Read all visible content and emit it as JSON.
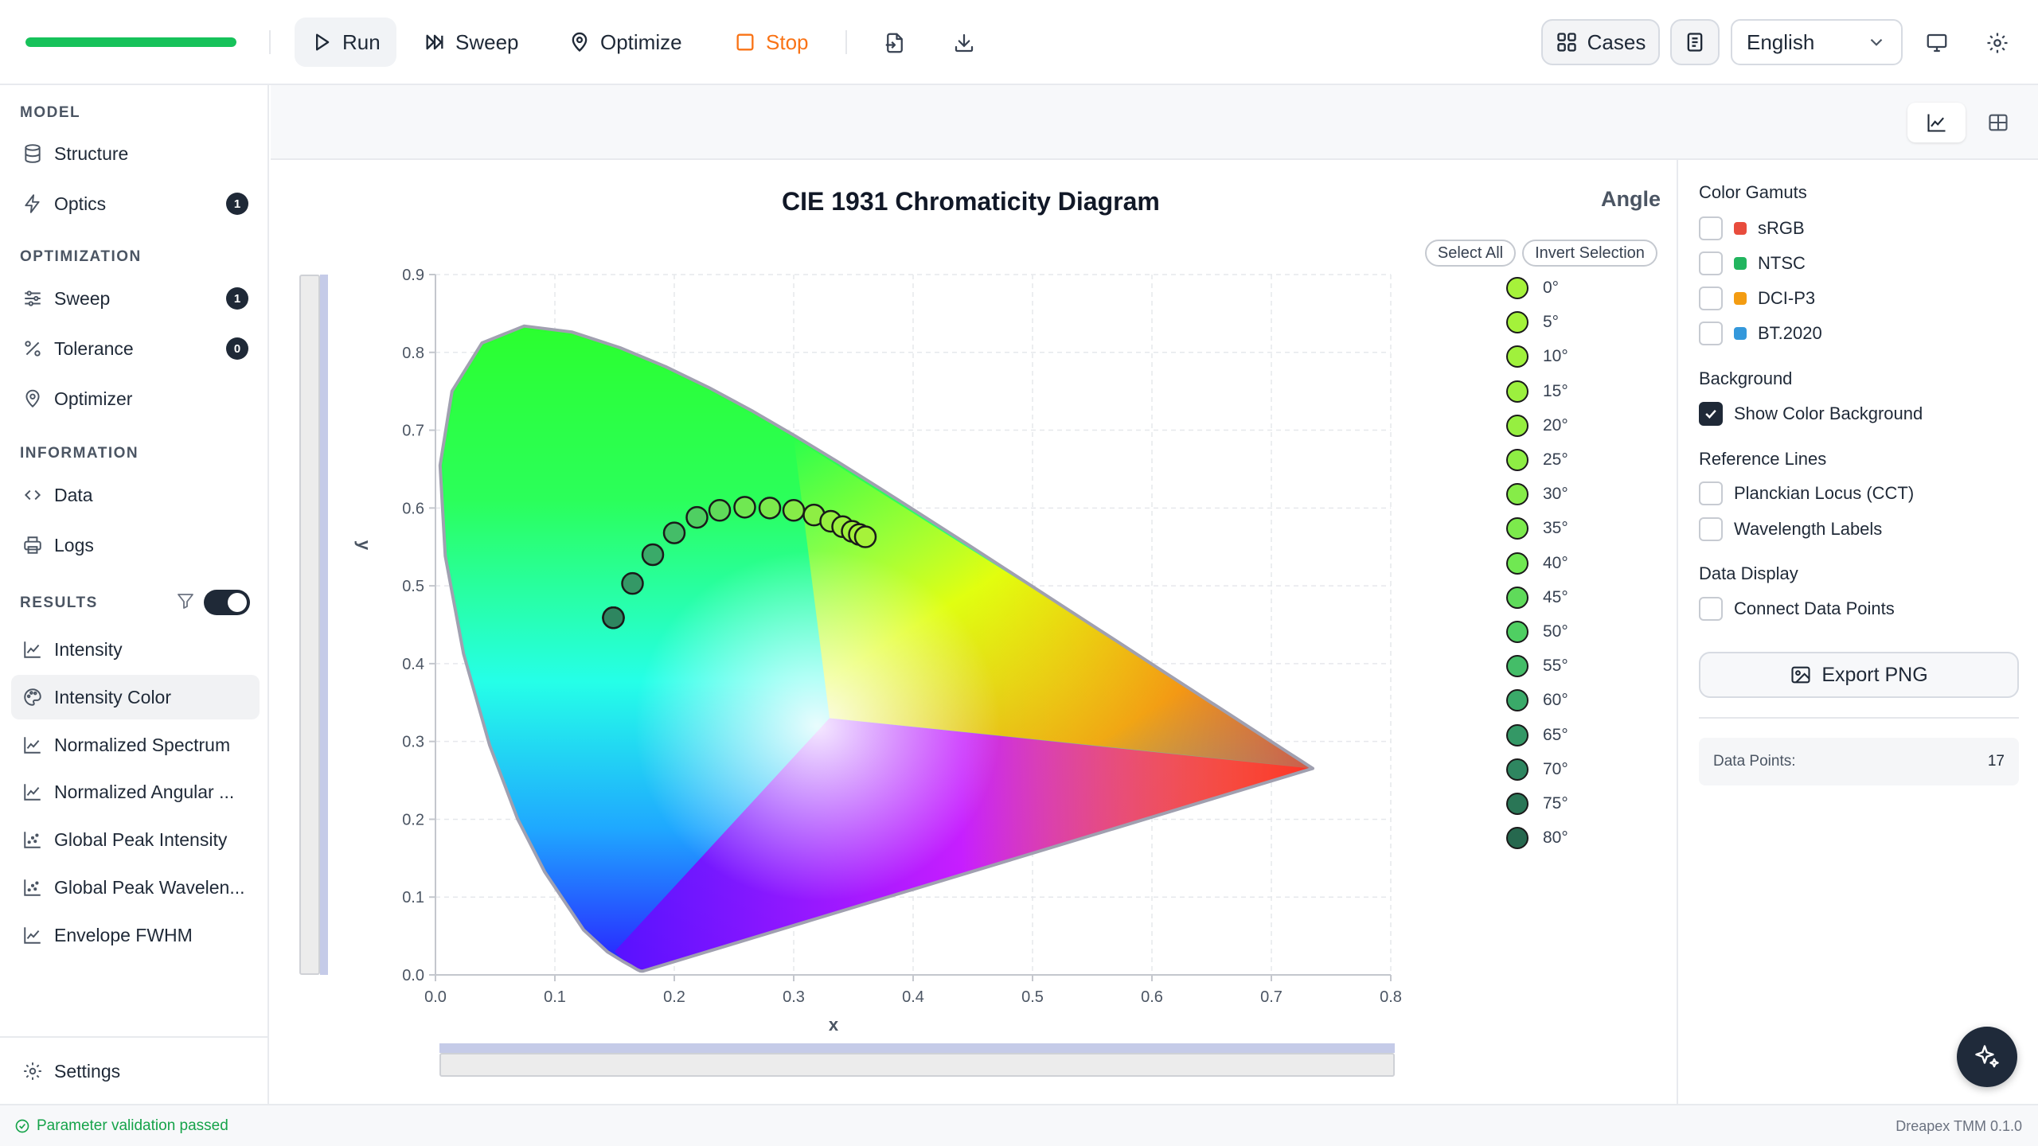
{
  "toolbar": {
    "progress": 1.0,
    "run_label": "Run",
    "sweep_label": "Sweep",
    "optimize_label": "Optimize",
    "stop_label": "Stop",
    "cases_label": "Cases",
    "language": "English",
    "accent_progress": "#16c25a",
    "stop_color": "#f97316"
  },
  "sidebar": {
    "model_heading": "MODEL",
    "structure": "Structure",
    "optics": "Optics",
    "optics_badge": "1",
    "optimization_heading": "OPTIMIZATION",
    "sweep": "Sweep",
    "sweep_badge": "1",
    "tolerance": "Tolerance",
    "tolerance_badge": "0",
    "optimizer": "Optimizer",
    "information_heading": "INFORMATION",
    "data": "Data",
    "logs": "Logs",
    "results_heading": "RESULTS",
    "results": [
      "Intensity",
      "Intensity Color",
      "Normalized Spectrum",
      "Normalized Angular ...",
      "Global Peak Intensity",
      "Global Peak Wavelen...",
      "Envelope FWHM"
    ],
    "selected_result": "Intensity Color",
    "settings": "Settings"
  },
  "chart": {
    "select_all": "Select All",
    "invert_selection": "Invert Selection",
    "legend_title": "Angle"
  },
  "chart_data": {
    "type": "scatter",
    "title": "CIE 1931 Chromaticity Diagram",
    "xlabel": "x",
    "ylabel": "y",
    "xlim": [
      0.0,
      0.8
    ],
    "ylim": [
      0.0,
      0.9
    ],
    "x_ticks": [
      "0.0",
      "0.1",
      "0.2",
      "0.3",
      "0.4",
      "0.5",
      "0.6",
      "0.7",
      "0.8"
    ],
    "y_ticks": [
      "0.0",
      "0.1",
      "0.2",
      "0.3",
      "0.4",
      "0.5",
      "0.6",
      "0.7",
      "0.8",
      "0.9"
    ],
    "grid": true,
    "color_background": true,
    "legend_position": "right",
    "series": [
      {
        "name": "0°",
        "x": 0.36,
        "y": 0.563,
        "color": "#a6f23a"
      },
      {
        "name": "5°",
        "x": 0.355,
        "y": 0.566,
        "color": "#a4f23a"
      },
      {
        "name": "10°",
        "x": 0.349,
        "y": 0.57,
        "color": "#a0f13c"
      },
      {
        "name": "15°",
        "x": 0.341,
        "y": 0.576,
        "color": "#9cf03e"
      },
      {
        "name": "20°",
        "x": 0.331,
        "y": 0.583,
        "color": "#96ef40"
      },
      {
        "name": "25°",
        "x": 0.317,
        "y": 0.591,
        "color": "#8eee44"
      },
      {
        "name": "30°",
        "x": 0.3,
        "y": 0.597,
        "color": "#86ec48"
      },
      {
        "name": "35°",
        "x": 0.28,
        "y": 0.6,
        "color": "#7cea4c"
      },
      {
        "name": "40°",
        "x": 0.259,
        "y": 0.601,
        "color": "#70e852"
      },
      {
        "name": "45°",
        "x": 0.238,
        "y": 0.597,
        "color": "#5fdb5a"
      },
      {
        "name": "50°",
        "x": 0.219,
        "y": 0.588,
        "color": "#4fcf62"
      },
      {
        "name": "55°",
        "x": 0.2,
        "y": 0.568,
        "color": "#44bd68"
      },
      {
        "name": "60°",
        "x": 0.182,
        "y": 0.54,
        "color": "#3aaa69"
      },
      {
        "name": "65°",
        "x": 0.165,
        "y": 0.503,
        "color": "#349866"
      },
      {
        "name": "70°",
        "x": 0.149,
        "y": 0.459,
        "color": "#2e8660"
      },
      {
        "name": "75°",
        "x": 0.149,
        "y": 0.459,
        "color": "#2a7656"
      },
      {
        "name": "80°",
        "x": 0.149,
        "y": 0.459,
        "color": "#26684e"
      }
    ]
  },
  "options": {
    "gamuts_heading": "Color Gamuts",
    "gamuts": [
      {
        "label": "sRGB",
        "color": "#e84c3d",
        "checked": false
      },
      {
        "label": "NTSC",
        "color": "#22b55f",
        "checked": false
      },
      {
        "label": "DCI-P3",
        "color": "#f39c12",
        "checked": false
      },
      {
        "label": "BT.2020",
        "color": "#3498db",
        "checked": false
      }
    ],
    "background_heading": "Background",
    "show_color_background": "Show Color Background",
    "show_color_background_checked": true,
    "reference_heading": "Reference Lines",
    "planckian": "Planckian Locus (CCT)",
    "wavelength_labels": "Wavelength Labels",
    "data_display_heading": "Data Display",
    "connect_points": "Connect Data Points",
    "export_label": "Export PNG",
    "data_points_label": "Data Points:",
    "data_points_value": "17"
  },
  "status": {
    "message": "Parameter validation passed",
    "version": "Dreapex TMM 0.1.0"
  }
}
